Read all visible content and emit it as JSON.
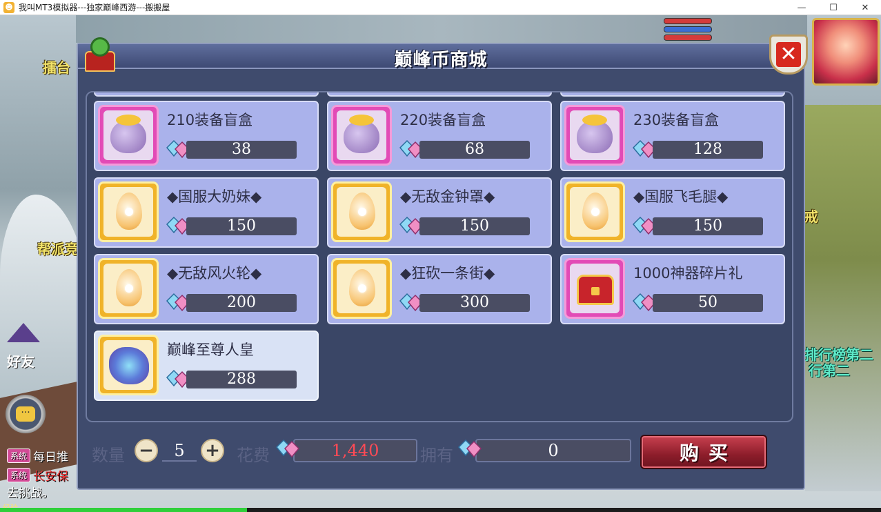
{
  "window": {
    "title": "我叫MT3模拟器---独家巅峰西游---搬搬屋",
    "minimize": "—",
    "maximize": "☐",
    "close": "✕"
  },
  "scene": {
    "labels": {
      "arena": "擂台",
      "guild": "帮派竞",
      "ranking1": "排行榜第二",
      "ranking2": "行第二",
      "right_text": "戒"
    },
    "friend_label": "好友",
    "chat_icon": "chat-bubble-icon",
    "system_messages": [
      {
        "tag": "系统",
        "text": "每日推",
        "extra": ""
      },
      {
        "tag": "系统",
        "text": "",
        "extra": "长安保"
      }
    ],
    "system_tail": "去挑战。",
    "exp_label": "经验",
    "exp_progress": 0.28
  },
  "shop": {
    "title": "巅峰币商城",
    "close_icon": "close-x-icon",
    "items": [
      {
        "name": "210装备盲盒",
        "price": "38",
        "icon": "mystery-bag-icon",
        "frame": "pink"
      },
      {
        "name": "220装备盲盒",
        "price": "68",
        "icon": "mystery-bag-icon",
        "frame": "pink"
      },
      {
        "name": "230装备盲盒",
        "price": "128",
        "icon": "mystery-bag-icon",
        "frame": "pink"
      },
      {
        "name": "◆国服大奶妹◆",
        "price": "150",
        "icon": "golden-egg-icon",
        "frame": "gold"
      },
      {
        "name": "◆无敌金钟罩◆",
        "price": "150",
        "icon": "golden-egg-icon",
        "frame": "gold"
      },
      {
        "name": "◆国服飞毛腿◆",
        "price": "150",
        "icon": "golden-egg-icon",
        "frame": "gold"
      },
      {
        "name": "◆无敌风火轮◆",
        "price": "200",
        "icon": "golden-egg-icon",
        "frame": "gold"
      },
      {
        "name": "◆狂砍一条街◆",
        "price": "300",
        "icon": "golden-egg-icon",
        "frame": "gold"
      },
      {
        "name": "1000神器碎片礼",
        "price": "50",
        "icon": "treasure-chest-icon",
        "frame": "pink"
      },
      {
        "name": "巅峰至尊人皇",
        "price": "288",
        "icon": "spirit-beast-icon",
        "frame": "gold",
        "selected": true
      }
    ],
    "currency_icon": "peak-gem-currency-icon",
    "quantity_label": "数量",
    "quantity": "5",
    "decrement": "−",
    "increment": "+",
    "cost_label": "花费",
    "cost": "1,440",
    "owned_label": "拥有",
    "owned": "0",
    "buy_label": "购买",
    "colors": {
      "panel": "#3f4b6d",
      "card": "#aab2eb",
      "card_selected": "#d9e2f5",
      "cost_text": "#ff4a55",
      "buy_button": "#a52a38"
    }
  }
}
